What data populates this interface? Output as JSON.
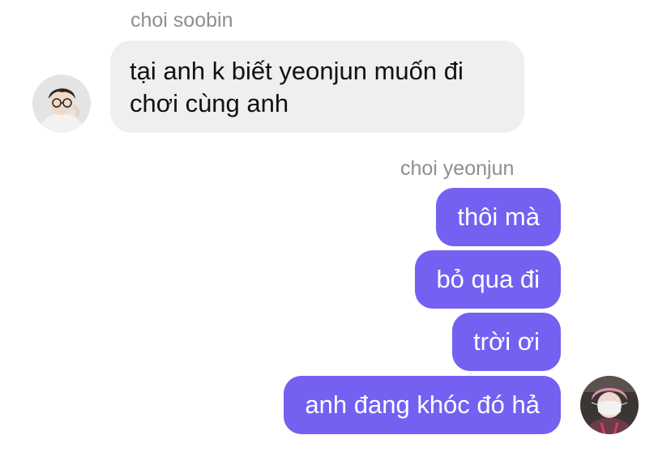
{
  "thread": {
    "incoming_group": {
      "sender_name": "choi soobin",
      "avatar_icon": "profile-photo-icon",
      "messages": [
        {
          "lines": [
            "tại anh k biết yeonjun muốn đi",
            "chơi cùng anh"
          ]
        }
      ]
    },
    "outgoing_group": {
      "sender_name": "choi yeonjun",
      "avatar_icon": "profile-photo-icon",
      "messages": [
        {
          "text": "thôi mà"
        },
        {
          "text": "bỏ qua đi"
        },
        {
          "text": "trời ơi"
        },
        {
          "text": "anh đang khóc đó hả"
        }
      ]
    }
  },
  "colors": {
    "incoming_bubble": "#efefef",
    "outgoing_bubble": "#7460f1",
    "sender_name_text": "#8e8e93",
    "incoming_text": "#111111",
    "outgoing_text": "#ffffff"
  }
}
